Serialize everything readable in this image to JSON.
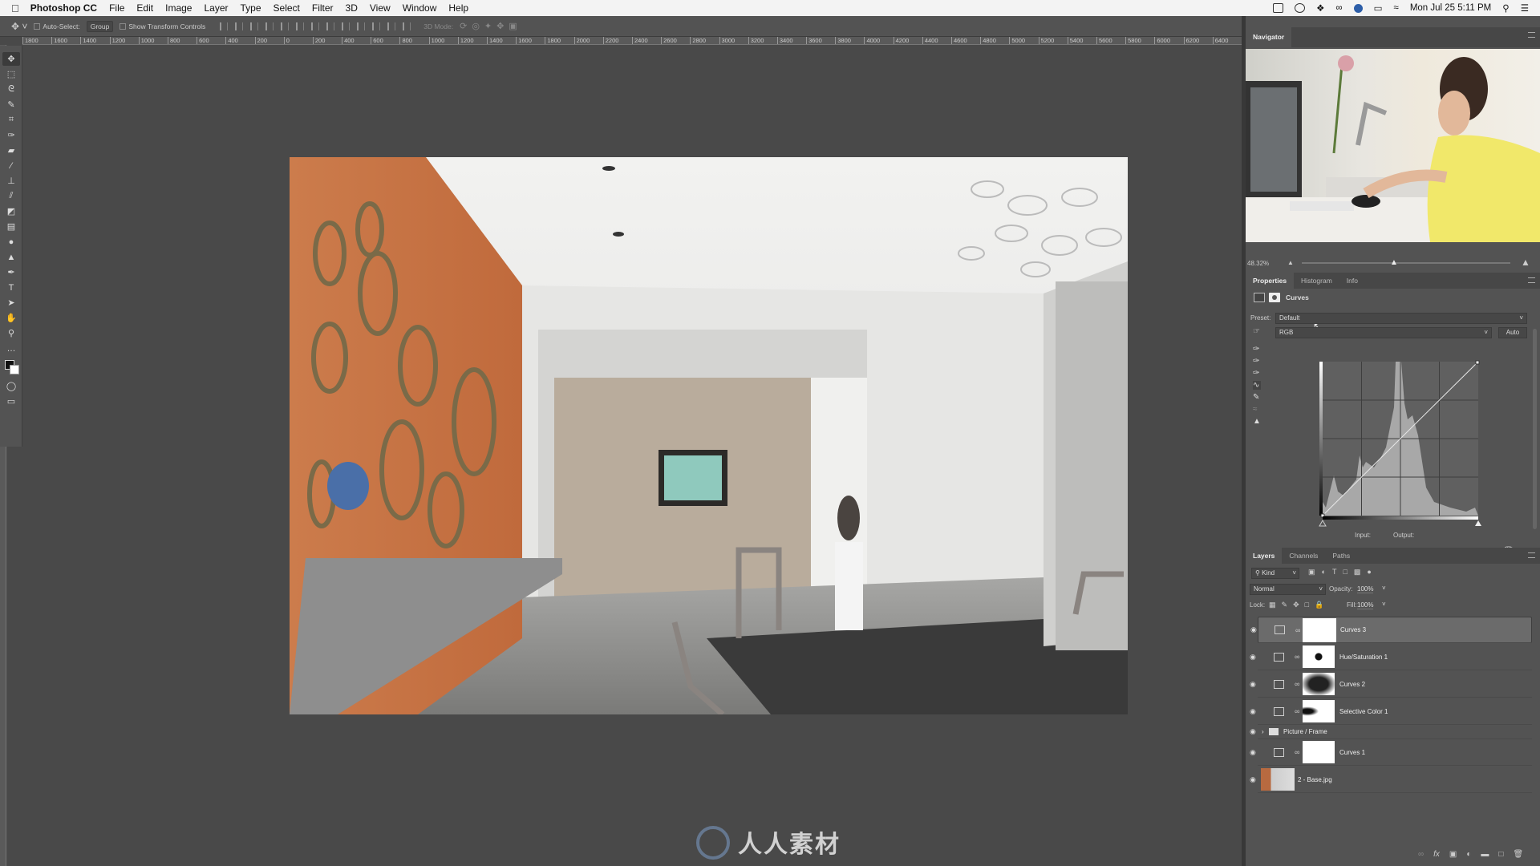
{
  "menubar": {
    "app": "Photoshop CC",
    "items": [
      "File",
      "Edit",
      "Image",
      "Layer",
      "Type",
      "Select",
      "Filter",
      "3D",
      "View",
      "Window",
      "Help"
    ],
    "clock": "Mon Jul 25  5:11 PM"
  },
  "options": {
    "auto_select": "Auto-Select:",
    "group": "Group",
    "show_transform": "Show Transform Controls",
    "mode3d": "3D Mode:"
  },
  "ruler": {
    "labels": [
      "1800",
      "1600",
      "1400",
      "1200",
      "1000",
      "800",
      "600",
      "400",
      "200",
      "0",
      "200",
      "400",
      "600",
      "800",
      "1000",
      "1200",
      "1400",
      "1600",
      "1800",
      "2000",
      "2200",
      "2400",
      "2600",
      "2800",
      "3000",
      "3200",
      "3400",
      "3600",
      "3800",
      "4000",
      "4200",
      "4400",
      "4600",
      "4800",
      "5000",
      "5200",
      "5400",
      "5600",
      "5800",
      "6000",
      "6200",
      "6400"
    ]
  },
  "tools": [
    "move-tool",
    "marquee-tool",
    "lasso-tool",
    "quick-select-tool",
    "crop-tool",
    "eyedropper-tool",
    "healing-tool",
    "brush-tool",
    "stamp-tool",
    "history-brush-tool",
    "eraser-tool",
    "gradient-tool",
    "blur-tool",
    "dodge-tool",
    "pen-tool",
    "type-tool",
    "path-select-tool",
    "hand-tool",
    "zoom-tool",
    "more-tool"
  ],
  "navigator": {
    "tab": "Navigator",
    "zoom": "48.32%"
  },
  "properties": {
    "tabs": [
      "Properties",
      "Histogram",
      "Info"
    ],
    "title": "Curves",
    "preset_label": "Preset:",
    "preset": "Default",
    "channel": "RGB",
    "auto": "Auto",
    "input_label": "Input:",
    "output_label": "Output:"
  },
  "layers": {
    "tabs": [
      "Layers",
      "Channels",
      "Paths"
    ],
    "kind": "Kind",
    "blend": "Normal",
    "opacity_label": "Opacity:",
    "opacity": "100%",
    "lock_label": "Lock:",
    "fill_label": "Fill:",
    "fill": "100%",
    "items": [
      {
        "name": "Curves 3",
        "type": "curves",
        "selected": true
      },
      {
        "name": "Hue/Saturation 1",
        "type": "hue"
      },
      {
        "name": "Curves 2",
        "type": "curves"
      },
      {
        "name": "Selective Color 1",
        "type": "selective"
      },
      {
        "name": "Picture / Frame",
        "type": "group"
      },
      {
        "name": "Curves 1",
        "type": "curves"
      },
      {
        "name": "2 - Base.jpg",
        "type": "image"
      }
    ]
  },
  "watermark": "人人素材",
  "colors": {
    "accent_wall": "#c8784a",
    "panel": "#535353",
    "canvas": "#494949"
  }
}
